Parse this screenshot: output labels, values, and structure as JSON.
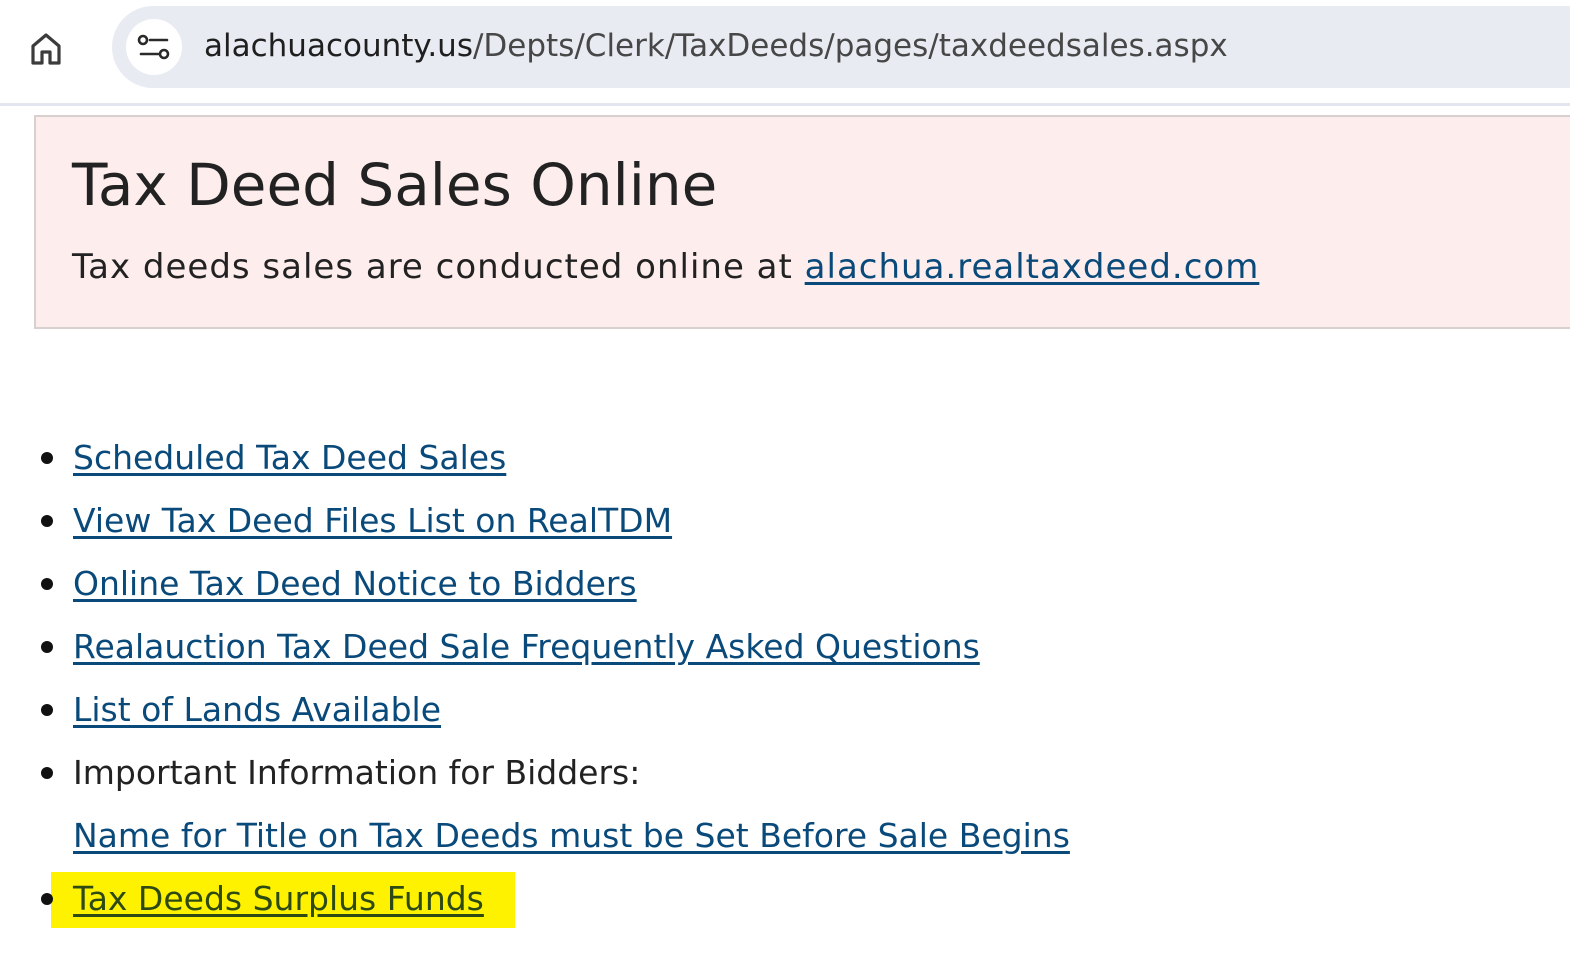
{
  "browser": {
    "home_icon": "home-icon",
    "site_info_icon": "tune-icon",
    "url_host": "alachuacounty.us",
    "url_path": "/Depts/Clerk/TaxDeeds/pages/taxdeedsales.aspx"
  },
  "banner": {
    "title": "Tax Deed Sales Online",
    "subtitle_prefix": "Tax deeds sales are conducted online at ",
    "subtitle_link": "alachua.realtaxdeed.com",
    "background": "#fdeeed"
  },
  "links": {
    "items": [
      {
        "label": "Scheduled Tax Deed Sales"
      },
      {
        "label": "View Tax Deed Files List on RealTDM"
      },
      {
        "label": "Online Tax Deed Notice to Bidders"
      },
      {
        "label": "Realauction Tax Deed Sale Frequently Asked Questions"
      },
      {
        "label": "List of Lands Available"
      },
      {
        "label": "Important Information for Bidders:"
      },
      {
        "label": "Name for Title on Tax Deeds must be Set Before Sale Begins"
      },
      {
        "label": "Tax Deeds Surplus Funds"
      }
    ]
  },
  "colors": {
    "link": "#0a4a7a",
    "highlight": "#fff200"
  }
}
